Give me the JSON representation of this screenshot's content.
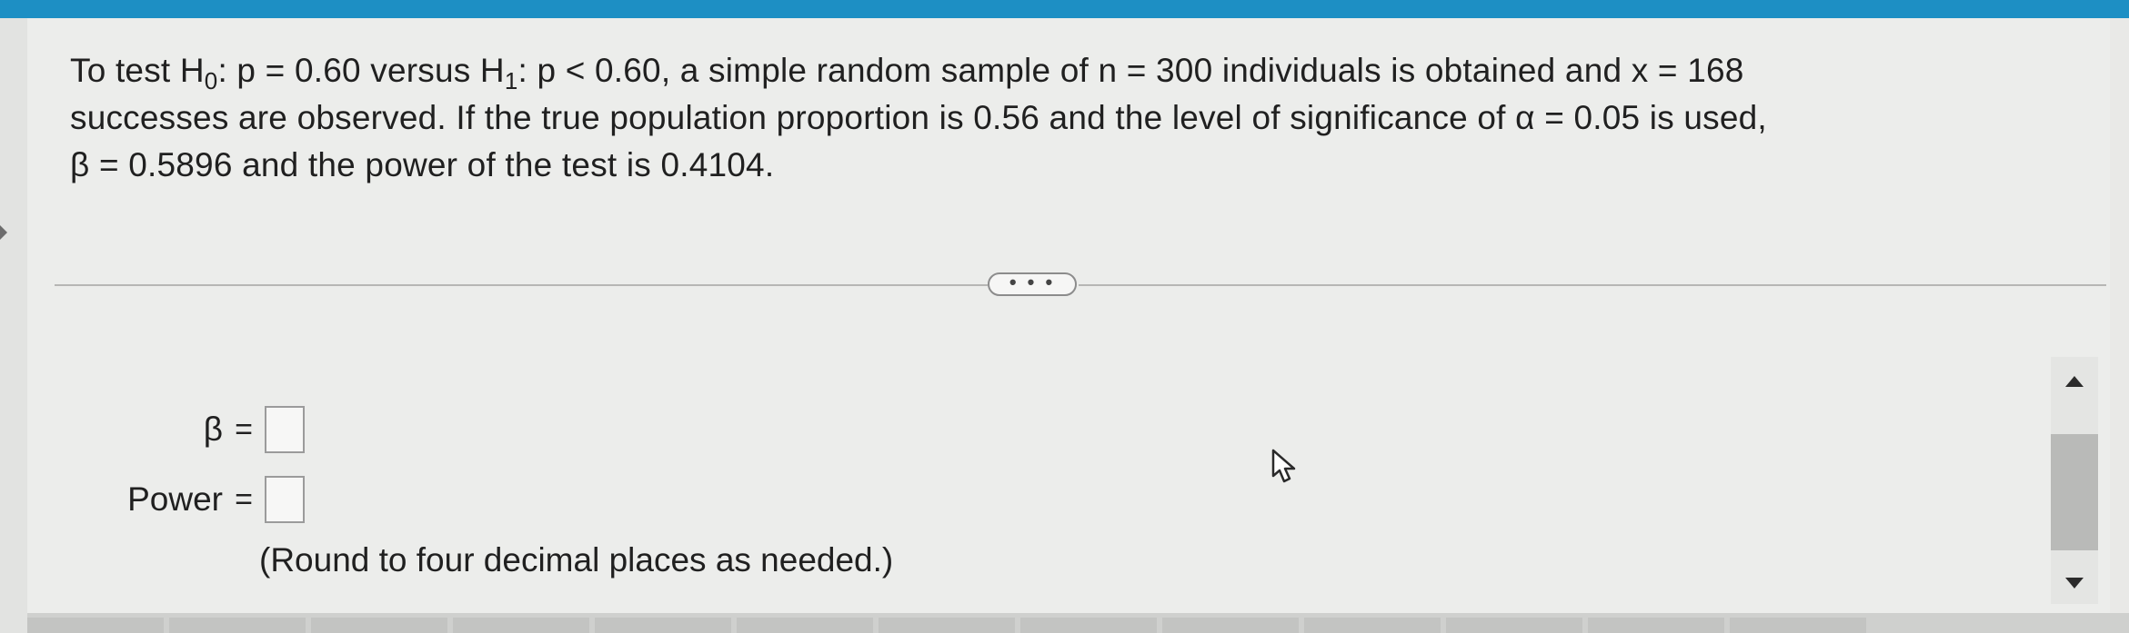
{
  "question": {
    "segment_1": "To test H",
    "h0_sub": "0",
    "segment_2": ": p = 0.60 versus H",
    "h1_sub": "1",
    "segment_3": ": p < 0.60, a simple random sample of n = 300 individuals is obtained and x = 168",
    "line_2": "successes are observed. If the true population proportion is 0.56 and the level of significance of α = 0.05 is used,",
    "line_3": "β = 0.5896 and the power of the test is 0.4104."
  },
  "more_button": {
    "label": "• • •"
  },
  "answers": {
    "beta_label": "β",
    "power_label": "Power",
    "equals": "=",
    "beta_value": "",
    "power_value": ""
  },
  "instruction": "(Round to four decimal places as needed.)",
  "colors": {
    "accent_bar": "#1d8fc4",
    "panel_background": "#ecedeb",
    "scroll_thumb": "#b9bab8"
  },
  "icons": {
    "cursor": "arrow-pointer-icon",
    "scroll_up": "triangle-up-icon",
    "scroll_down": "triangle-down-icon"
  }
}
